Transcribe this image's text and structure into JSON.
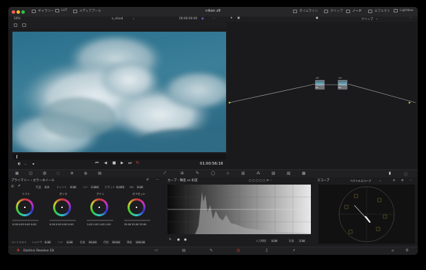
{
  "window": {
    "title": "nikon z9"
  },
  "titlebar": {
    "left_items": [
      "ギャラリー",
      "LUT",
      "メディアプール"
    ],
    "right_items": [
      "タイムライン",
      "クリップ",
      "ノード",
      "エフェクト",
      "Lightbox"
    ]
  },
  "viewer": {
    "zoom": "50%",
    "clip_name": "x_cloud",
    "timecode_top": "00:00:00:00",
    "timecode": "01:00:56:18"
  },
  "node_editor": {
    "mode_label": "クリップ",
    "nodes": [
      {
        "id": "01",
        "label": "sdr"
      },
      {
        "id": "02",
        "label": "sdr"
      }
    ]
  },
  "primaries": {
    "title": "プライマリー・カラーホイール",
    "params_row": [
      {
        "label": "色温",
        "value": "0.0"
      },
      {
        "label": "ティント",
        "value": "0.00"
      },
      {
        "label": "コン",
        "value": "1.000"
      },
      {
        "label": "ピボット",
        "value": "0.435"
      },
      {
        "label": "MD",
        "value": "0.00"
      }
    ],
    "wheels": [
      {
        "name": "リフト",
        "values": [
          "0.00",
          "0.00",
          "0.00",
          "0.00"
        ]
      },
      {
        "name": "ガンマ",
        "values": [
          "0.00",
          "0.00",
          "0.00",
          "0.00"
        ]
      },
      {
        "name": "ゲイン",
        "values": [
          "1.00",
          "1.00",
          "1.00",
          "1.00"
        ]
      },
      {
        "name": "オフセット",
        "values": [
          "25.00",
          "25.00",
          "25.00"
        ]
      }
    ],
    "bottom_params": [
      {
        "label": "コントラスト",
        "value": ""
      },
      {
        "label": "シャドウ",
        "value": "0.00"
      },
      {
        "label": "ハイ",
        "value": "0.00"
      },
      {
        "label": "彩度",
        "value": "50.00"
      },
      {
        "label": "色相",
        "value": "50.00"
      },
      {
        "label": "輝度",
        "value": "100.00"
      }
    ]
  },
  "curves": {
    "title": "カーブ - 輝度 vs 彩度",
    "input_label": "入力輝度",
    "input_value": "0.00",
    "sat_label": "彩度",
    "sat_value": "1.00"
  },
  "scope": {
    "title": "スコープ",
    "mode": "ベクトルスコープ"
  },
  "footer": {
    "app_name": "DaVinci Resolve 18"
  },
  "colors": {
    "accent": "#e0432c",
    "node_link": "#9fcf3e",
    "bg": "#1b1b1d"
  }
}
